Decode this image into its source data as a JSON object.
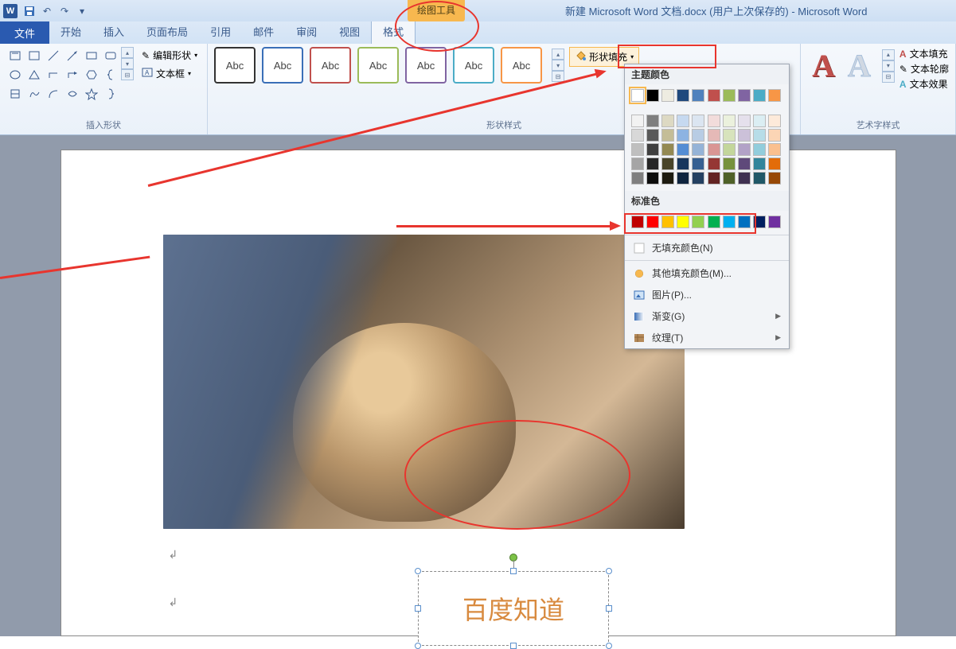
{
  "window": {
    "title": "新建 Microsoft Word 文档.docx (用户上次保存的) - Microsoft Word",
    "drawing_tools_label": "绘图工具"
  },
  "tabs": {
    "file": "文件",
    "home": "开始",
    "insert": "插入",
    "page_layout": "页面布局",
    "references": "引用",
    "mailings": "邮件",
    "review": "审阅",
    "view": "视图",
    "format": "格式"
  },
  "ribbon": {
    "insert_shapes": {
      "label": "插入形状",
      "edit_shape": "编辑形状",
      "text_box": "文本框"
    },
    "shape_styles": {
      "label": "形状样式",
      "abc": "Abc",
      "shape_fill": "形状填充"
    },
    "wordart_styles": {
      "label": "艺术字样式",
      "text_fill": "文本填充",
      "text_outline": "文本轮廓",
      "text_effects": "文本效果"
    }
  },
  "color_panel": {
    "theme_label": "主题颜色",
    "standard_label": "标准色",
    "no_fill": "无填充颜色(N)",
    "more_colors": "其他填充颜色(M)...",
    "picture": "图片(P)...",
    "gradient": "渐变(G)",
    "texture": "纹理(T)",
    "theme_row1": [
      "#ffffff",
      "#000000",
      "#eeece1",
      "#1f497d",
      "#4f81bd",
      "#c0504d",
      "#9bbb59",
      "#8064a2",
      "#4bacc6",
      "#f79646"
    ],
    "theme_shades": [
      [
        "#f2f2f2",
        "#7f7f7f",
        "#ddd9c3",
        "#c6d9f0",
        "#dbe5f1",
        "#f2dcdb",
        "#ebf1dd",
        "#e5e0ec",
        "#dbeef3",
        "#fdeada"
      ],
      [
        "#d8d8d8",
        "#595959",
        "#c4bd97",
        "#8db3e2",
        "#b8cce4",
        "#e5b9b7",
        "#d7e3bc",
        "#ccc1d9",
        "#b7dde8",
        "#fbd5b5"
      ],
      [
        "#bfbfbf",
        "#3f3f3f",
        "#938953",
        "#548dd4",
        "#95b3d7",
        "#d99694",
        "#c3d69b",
        "#b2a2c7",
        "#92cddc",
        "#fac08f"
      ],
      [
        "#a5a5a5",
        "#262626",
        "#494429",
        "#17365d",
        "#366092",
        "#953734",
        "#76923c",
        "#5f497a",
        "#31859b",
        "#e36c09"
      ],
      [
        "#7f7f7f",
        "#0c0c0c",
        "#1d1b10",
        "#0f243e",
        "#244061",
        "#632423",
        "#4f6128",
        "#3f3151",
        "#205867",
        "#974806"
      ]
    ],
    "standard_row": [
      "#c00000",
      "#ff0000",
      "#ffc000",
      "#ffff00",
      "#92d050",
      "#00b050",
      "#00b0f0",
      "#0070c0",
      "#002060",
      "#7030a0"
    ]
  },
  "document": {
    "textbox_content": "百度知道"
  },
  "style_colors": [
    "#333333",
    "#3a6fb7",
    "#c0504d",
    "#9bbb59",
    "#8064a2",
    "#4bacc6",
    "#f79646"
  ]
}
